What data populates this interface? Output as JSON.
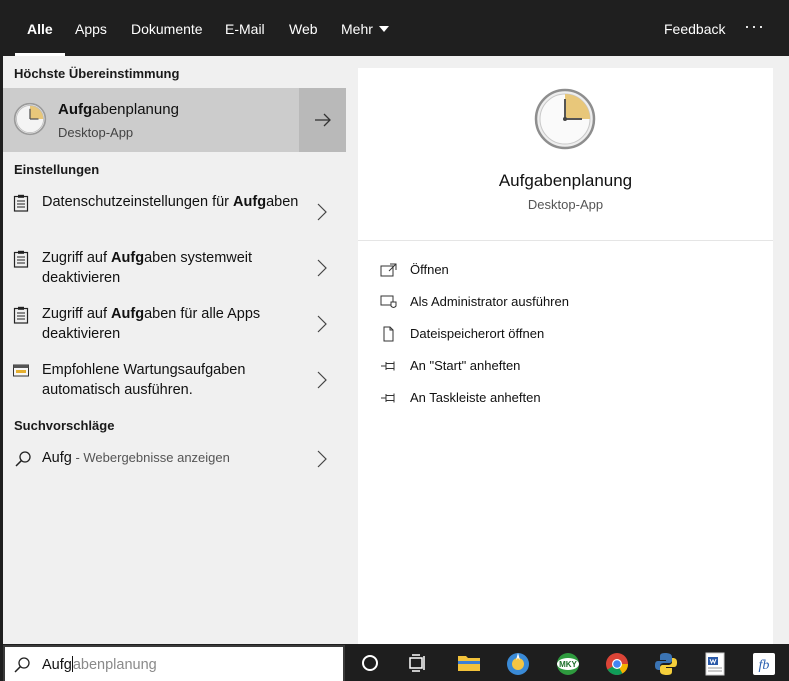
{
  "tabs": [
    {
      "label": "Alle",
      "active": true
    },
    {
      "label": "Apps"
    },
    {
      "label": "Dokumente"
    },
    {
      "label": "E-Mail"
    },
    {
      "label": "Web"
    },
    {
      "label": "Mehr"
    }
  ],
  "header": {
    "feedback_label": "Feedback",
    "more_options": "···"
  },
  "best_match": {
    "section_title": "Höchste Übereinstimmung",
    "name_bold": "Aufg",
    "name_rest": "abenplanung",
    "subtitle": "Desktop-App",
    "icon": "clock-icon"
  },
  "settings": {
    "section_title": "Einstellungen",
    "items": [
      {
        "pre": "Datenschutzeinstellungen für ",
        "bold": "Aufg",
        "post": "aben",
        "icon": "clipboard-icon"
      },
      {
        "pre": "Zugriff auf ",
        "bold": "Aufg",
        "post": "aben systemweit deaktivieren",
        "icon": "clipboard-icon"
      },
      {
        "pre": "Zugriff auf ",
        "bold": "Aufg",
        "post": "aben für alle Apps deaktivieren",
        "icon": "clipboard-icon"
      },
      {
        "pre": "Empfohlene Wartungsaufgaben automatisch ausführen.",
        "bold": "",
        "post": "",
        "icon": "maintenance-icon"
      }
    ]
  },
  "suggestions": {
    "section_title": "Suchvorschläge",
    "query": "Aufg",
    "sub": " - Webergebnisse anzeigen"
  },
  "preview": {
    "title": "Aufgabenplanung",
    "subtitle": "Desktop-App",
    "actions": [
      {
        "label": "Öffnen",
        "icon": "open-icon"
      },
      {
        "label": "Als Administrator ausführen",
        "icon": "run-as-admin-icon"
      },
      {
        "label": "Dateispeicherort öffnen",
        "icon": "file-location-icon"
      },
      {
        "label": "An \"Start\" anheften",
        "icon": "pin-icon"
      },
      {
        "label": "An Taskleiste anheften",
        "icon": "pin-icon"
      }
    ]
  },
  "search": {
    "typed": "Aufg",
    "completion": "abenplanung"
  },
  "taskbar": {
    "items": [
      "cortana-icon",
      "task-view-icon",
      "file-explorer-icon",
      "app-icon",
      "mky-icon",
      "chrome-icon",
      "python-icon",
      "word-icon",
      "fb-icon"
    ],
    "mky_text": "MKY",
    "fb_text": "fb"
  },
  "colors": {
    "accent_bg": "#1f1f1f",
    "panel_bg": "#f0f0f0",
    "selected_bg": "#cccccc",
    "clock_face": "#e8c77a"
  }
}
